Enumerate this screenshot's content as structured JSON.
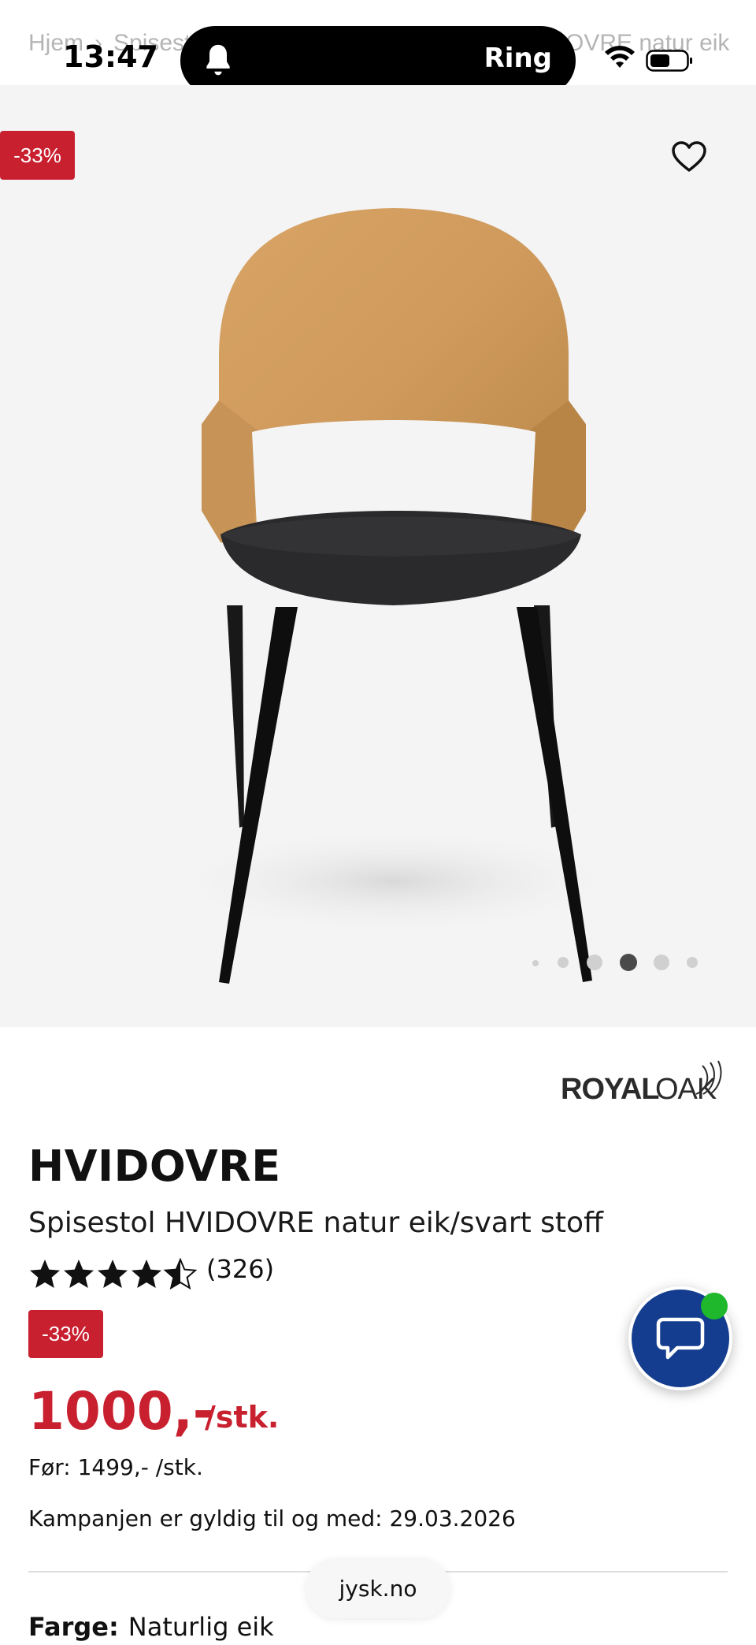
{
  "status_bar": {
    "time": "13:47",
    "island_label": "Ring",
    "breadcrumb_start": "Hjem",
    "breadcrumb_mid": "Spisest",
    "breadcrumb_end": "OVRE natur eik"
  },
  "gallery": {
    "badge": "-33%",
    "dots_total": 6,
    "active_index": 3
  },
  "product": {
    "brand": "ROYAL OAK",
    "brand_part1": "ROYAL",
    "brand_part2": "OAK",
    "name": "HVIDOVRE",
    "description": "Spisestol HVIDOVRE natur eik/svart stoff",
    "rating": 4.5,
    "review_count": "(326)",
    "discount": "-33%",
    "price": "1000,-",
    "price_unit": "/stk.",
    "price_before": "Før: 1499,- /stk.",
    "campaign": "Kampanjen er gyldig til og med: 29.03.2026",
    "color_label": "Farge:",
    "color_value": "Naturlig eik"
  },
  "browser": {
    "url": "jysk.no"
  },
  "colors": {
    "accent_red": "#c8202f",
    "chat_blue": "#143d8f",
    "online_green": "#1fb82c"
  }
}
